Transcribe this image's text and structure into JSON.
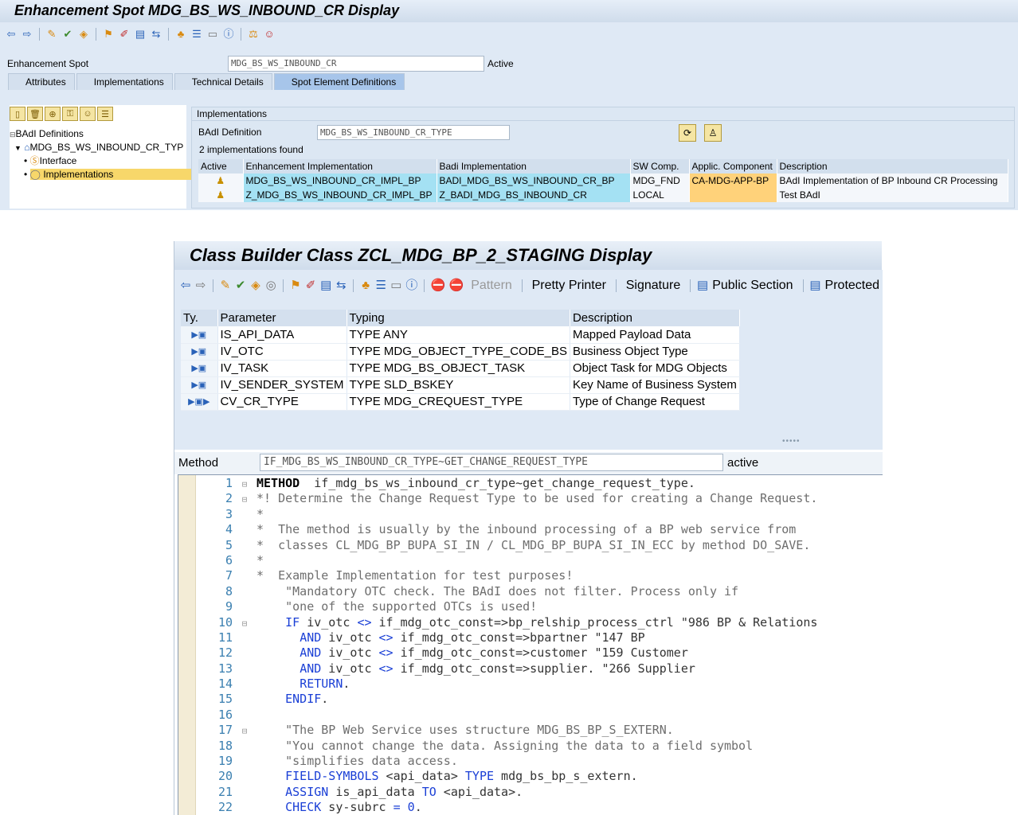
{
  "enhancement": {
    "title": "Enhancement Spot MDG_BS_WS_INBOUND_CR Display",
    "spot_label": "Enhancement Spot",
    "spot_value": "MDG_BS_WS_INBOUND_CR",
    "spot_status": "Active",
    "tabs": [
      {
        "label": "Attributes"
      },
      {
        "label": "Implementations"
      },
      {
        "label": "Technical Details"
      },
      {
        "label": "Spot Element Definitions"
      }
    ],
    "tree": {
      "root": "BAdI Definitions",
      "badi": "MDG_BS_WS_INBOUND_CR_TYP",
      "interface": "Interface",
      "implementations": "Implementations"
    },
    "impl_panel": {
      "header": "Implementations",
      "badi_label": "BAdI Definition",
      "badi_value": "MDG_BS_WS_INBOUND_CR_TYPE",
      "found_text": "2  implementations found",
      "columns": [
        "Active",
        "Enhancement Implementation",
        "Badi Implementation",
        "SW Comp.",
        "Applic. Component",
        "Description"
      ],
      "rows": [
        {
          "enh": "MDG_BS_WS_INBOUND_CR_IMPL_BP",
          "badi": "BADI_MDG_BS_WS_INBOUND_CR_BP",
          "sw": "MDG_FND",
          "app": "CA-MDG-APP-BP",
          "desc": "BAdI Implementation of BP Inbound CR Processing"
        },
        {
          "enh": "Z_MDG_BS_WS_INBOUND_CR_IMPL_BP",
          "badi": "Z_BADI_MDG_BS_INBOUND_CR",
          "sw": "LOCAL",
          "app": "",
          "desc": "Test BAdI"
        }
      ]
    }
  },
  "classbuilder": {
    "title": "Class Builder Class ZCL_MDG_BP_2_STAGING Display",
    "toolbar": {
      "pattern": "Pattern",
      "pretty_printer": "Pretty Printer",
      "signature": "Signature",
      "public_section": "Public Section",
      "protected": "Protected"
    },
    "params": {
      "columns": [
        "Ty.",
        "Parameter",
        "Typing",
        "Description"
      ],
      "rows": [
        {
          "ty": "▶▣",
          "name": "IS_API_DATA",
          "typing": "TYPE ANY",
          "desc": "Mapped Payload Data"
        },
        {
          "ty": "▶▣",
          "name": "IV_OTC",
          "typing": "TYPE MDG_OBJECT_TYPE_CODE_BS",
          "desc": "Business Object Type"
        },
        {
          "ty": "▶▣",
          "name": "IV_TASK",
          "typing": "TYPE MDG_BS_OBJECT_TASK",
          "desc": "Object Task for MDG Objects"
        },
        {
          "ty": "▶▣",
          "name": "IV_SENDER_SYSTEM",
          "typing": "TYPE SLD_BSKEY",
          "desc": "Key Name of Business System"
        },
        {
          "ty": "▶▣▶",
          "name": "CV_CR_TYPE",
          "typing": "TYPE MDG_CREQUEST_TYPE",
          "desc": "Type of Change Request"
        }
      ]
    },
    "method_label": "Method",
    "method_value": "IF_MDG_BS_WS_INBOUND_CR_TYPE~GET_CHANGE_REQUEST_TYPE",
    "method_status": "active",
    "code": [
      {
        "n": "1",
        "fold": "⊟",
        "t": "kwline",
        "parts": [
          [
            "kwb",
            "METHOD"
          ],
          [
            "",
            "  if_mdg_bs_ws_inbound_cr_type~get_change_request_type."
          ]
        ]
      },
      {
        "n": "2",
        "fold": "⊟",
        "t": "cmt",
        "text": "*! Determine the Change Request Type to be used for creating a Change Request."
      },
      {
        "n": "3",
        "fold": "",
        "t": "cmt",
        "text": "*"
      },
      {
        "n": "4",
        "fold": "",
        "t": "cmt",
        "text": "*  The method is usually by the inbound processing of a BP web service from"
      },
      {
        "n": "5",
        "fold": "",
        "t": "cmt",
        "text": "*  classes CL_MDG_BP_BUPA_SI_IN / CL_MDG_BP_BUPA_SI_IN_ECC by method DO_SAVE."
      },
      {
        "n": "6",
        "fold": "",
        "t": "cmt",
        "text": "*"
      },
      {
        "n": "7",
        "fold": "",
        "t": "cmt",
        "text": "*  Example Implementation for test purposes!"
      },
      {
        "n": "8",
        "fold": "",
        "t": "str",
        "text": "    \"Mandatory OTC check. The BAdI does not filter. Process only if"
      },
      {
        "n": "9",
        "fold": "",
        "t": "str",
        "text": "    \"one of the supported OTCs is used!"
      },
      {
        "n": "10",
        "fold": "⊟",
        "t": "kwline",
        "parts": [
          [
            "",
            "    "
          ],
          [
            "kw",
            "IF"
          ],
          [
            "",
            " iv_otc "
          ],
          [
            "kw",
            "<>"
          ],
          [
            "",
            " if_mdg_otc_const=>bp_relship_process_ctrl \"986 BP & Relations"
          ]
        ]
      },
      {
        "n": "11",
        "fold": "",
        "t": "kwline",
        "parts": [
          [
            "",
            "      "
          ],
          [
            "kw",
            "AND"
          ],
          [
            "",
            " iv_otc "
          ],
          [
            "kw",
            "<>"
          ],
          [
            "",
            " if_mdg_otc_const=>bpartner \"147 BP"
          ]
        ]
      },
      {
        "n": "12",
        "fold": "",
        "t": "kwline",
        "parts": [
          [
            "",
            "      "
          ],
          [
            "kw",
            "AND"
          ],
          [
            "",
            " iv_otc "
          ],
          [
            "kw",
            "<>"
          ],
          [
            "",
            " if_mdg_otc_const=>customer \"159 Customer"
          ]
        ]
      },
      {
        "n": "13",
        "fold": "",
        "t": "kwline",
        "parts": [
          [
            "",
            "      "
          ],
          [
            "kw",
            "AND"
          ],
          [
            "",
            " iv_otc "
          ],
          [
            "kw",
            "<>"
          ],
          [
            "",
            " if_mdg_otc_const=>supplier. \"266 Supplier"
          ]
        ]
      },
      {
        "n": "14",
        "fold": "",
        "t": "kwline",
        "parts": [
          [
            "",
            "      "
          ],
          [
            "kw",
            "RETURN"
          ],
          [
            "",
            "."
          ]
        ]
      },
      {
        "n": "15",
        "fold": "",
        "t": "kwline",
        "parts": [
          [
            "",
            "    "
          ],
          [
            "kw",
            "ENDIF"
          ],
          [
            "",
            "."
          ]
        ]
      },
      {
        "n": "16",
        "fold": "",
        "t": "cmt",
        "text": ""
      },
      {
        "n": "17",
        "fold": "⊟",
        "t": "str",
        "text": "    \"The BP Web Service uses structure MDG_BS_BP_S_EXTERN."
      },
      {
        "n": "18",
        "fold": "",
        "t": "str",
        "text": "    \"You cannot change the data. Assigning the data to a field symbol"
      },
      {
        "n": "19",
        "fold": "",
        "t": "str",
        "text": "    \"simplifies data access."
      },
      {
        "n": "20",
        "fold": "",
        "t": "kwline",
        "parts": [
          [
            "",
            "    "
          ],
          [
            "kw",
            "FIELD-SYMBOLS"
          ],
          [
            "",
            " <api_data> "
          ],
          [
            "kw",
            "TYPE"
          ],
          [
            "",
            " mdg_bs_bp_s_extern."
          ]
        ]
      },
      {
        "n": "21",
        "fold": "",
        "t": "kwline",
        "parts": [
          [
            "",
            "    "
          ],
          [
            "kw",
            "ASSIGN"
          ],
          [
            "",
            " is_api_data "
          ],
          [
            "kw",
            "TO"
          ],
          [
            "",
            " <api_data>."
          ]
        ]
      },
      {
        "n": "22",
        "fold": "",
        "t": "kwline",
        "parts": [
          [
            "",
            "    "
          ],
          [
            "kw",
            "CHECK"
          ],
          [
            "",
            " sy-subrc "
          ],
          [
            "kw",
            "="
          ],
          [
            "",
            " "
          ],
          [
            "kw",
            "0"
          ],
          [
            "",
            "."
          ]
        ]
      }
    ]
  }
}
